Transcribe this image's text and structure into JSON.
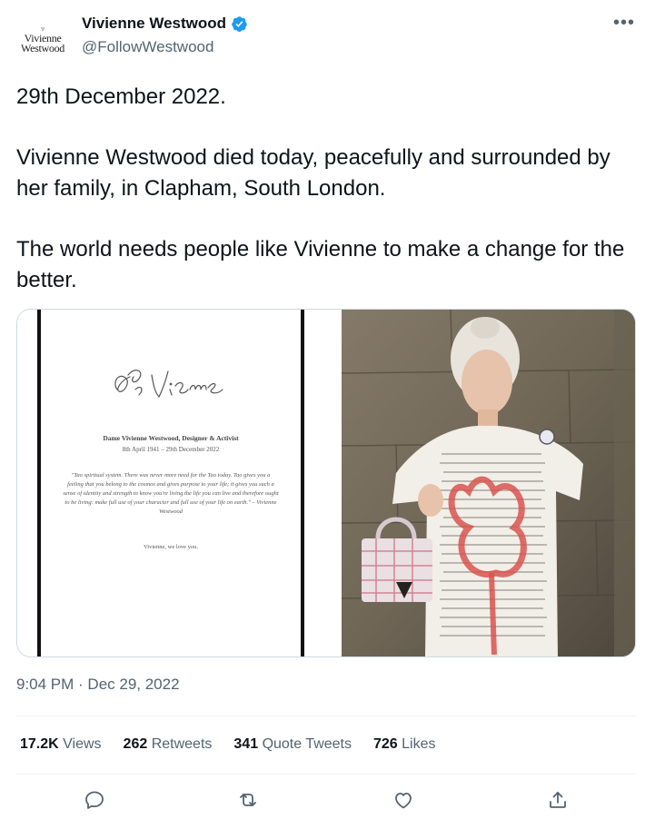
{
  "user": {
    "display_name": "Vivienne Westwood",
    "handle": "@FollowWestwood",
    "avatar_logo": [
      "Vivienne",
      "Westwood"
    ],
    "verified_icon": "verified-badge-icon"
  },
  "more_label": "•••",
  "tweet": {
    "paragraphs": [
      "29th December 2022.",
      "Vivienne Westwood died today, peacefully and surrounded by her family, in Clapham, South London.",
      "The world needs people like Vivienne to make a change for the better."
    ]
  },
  "media": {
    "card": {
      "title": "Dame Vivienne Westwood, Designer & Activist",
      "dates": "8th April 1941 – 29th December 2022",
      "quote": "\"Tao spiritual system. There was never more need for the Tao today. Tao gives you a feeling that you belong to the cosmos and gives purpose to your life; it gives you such a sense of identity and strength to know you're living the life you can live and therefore ought to be living: make full use of your character and full use of your life on earth.\" – Vivienne Westwood",
      "closing": "Vivienne, we love you."
    }
  },
  "timestamp": "9:04 PM · Dec 29, 2022",
  "stats": [
    {
      "num": "17.2K",
      "label": "Views"
    },
    {
      "num": "262",
      "label": "Retweets"
    },
    {
      "num": "341",
      "label": "Quote Tweets"
    },
    {
      "num": "726",
      "label": "Likes"
    }
  ],
  "actions": [
    "reply-icon",
    "retweet-icon",
    "like-icon",
    "share-icon"
  ],
  "colors": {
    "text": "#0f1419",
    "secondary": "#536471",
    "verified": "#1d9bf0",
    "border": "#cfd9de"
  }
}
